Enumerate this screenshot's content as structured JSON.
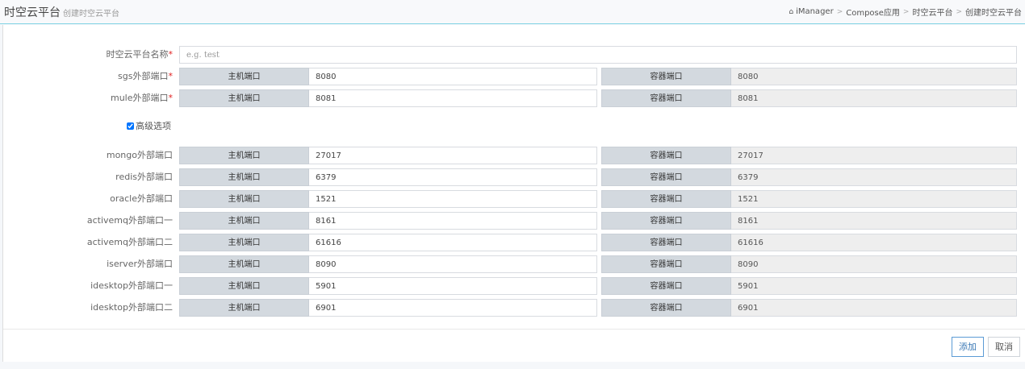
{
  "header": {
    "title": "时空云平台",
    "subtitle": "创建时空云平台"
  },
  "breadcrumb": {
    "home_icon": "home-icon",
    "items": [
      "iManager",
      "Compose应用",
      "时空云平台",
      "创建时空云平台"
    ],
    "separator": ">"
  },
  "form": {
    "name_label": "时空云平台名称",
    "required_mark": "*",
    "name_placeholder": "e.g. test",
    "host_port_label": "主机端口",
    "container_port_label": "容器端口",
    "required_ports": [
      {
        "label": "sgs外部端口",
        "host": "8080",
        "container": "8080"
      },
      {
        "label": "mule外部端口",
        "host": "8081",
        "container": "8081"
      }
    ],
    "advanced_label": "高级选项",
    "advanced_checked": true,
    "advanced_ports": [
      {
        "label": "mongo外部端口",
        "host": "27017",
        "container": "27017"
      },
      {
        "label": "redis外部端口",
        "host": "6379",
        "container": "6379"
      },
      {
        "label": "oracle外部端口",
        "host": "1521",
        "container": "1521"
      },
      {
        "label": "activemq外部端口一",
        "host": "8161",
        "container": "8161"
      },
      {
        "label": "activemq外部端口二",
        "host": "61616",
        "container": "61616"
      },
      {
        "label": "iserver外部端口",
        "host": "8090",
        "container": "8090"
      },
      {
        "label": "idesktop外部端口一",
        "host": "5901",
        "container": "5901"
      },
      {
        "label": "idesktop外部端口二",
        "host": "6901",
        "container": "6901"
      }
    ]
  },
  "footer": {
    "add_label": "添加",
    "cancel_label": "取消"
  }
}
